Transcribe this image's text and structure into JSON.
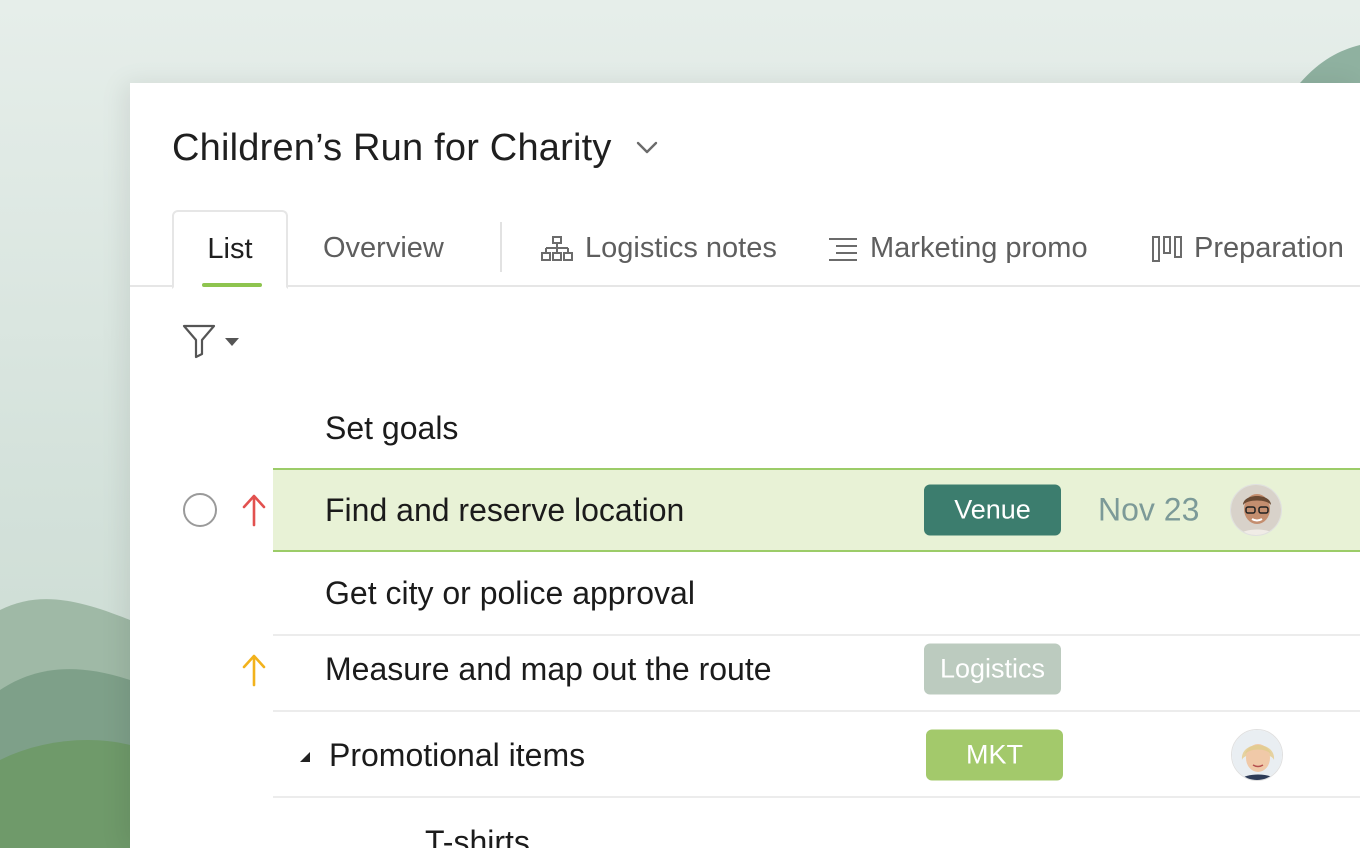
{
  "project": {
    "title": "Children’s Run for Charity"
  },
  "tabs": [
    {
      "label": "List",
      "active": true
    },
    {
      "label": "Overview",
      "active": false
    },
    {
      "label": "Logistics notes",
      "active": false,
      "icon": "hierarchy-icon"
    },
    {
      "label": "Marketing promo",
      "active": false,
      "icon": "text-lines-icon"
    },
    {
      "label": "Preparation",
      "active": false,
      "icon": "board-columns-icon"
    }
  ],
  "filter": {
    "icon": "filter-icon"
  },
  "tasks": [
    {
      "name": "Set goals"
    },
    {
      "name": "Find and reserve location",
      "priority": "high",
      "priority_color": "#e2514f",
      "tag": "Venue",
      "tag_color": "#3c7d6e",
      "due": "Nov 23",
      "assignee": "male-avatar",
      "selected": true
    },
    {
      "name": "Get city or police approval"
    },
    {
      "name": "Measure and map out the route",
      "priority": "medium",
      "priority_color": "#f2b21c",
      "tag": "Logistics",
      "tag_color": "#bccbbf"
    },
    {
      "name": "Promotional items",
      "collapsible": true,
      "expanded": true,
      "tag": "MKT",
      "tag_color": "#a3c96b",
      "assignee": "female-avatar"
    },
    {
      "name": "T-shirts",
      "subtask": true
    }
  ],
  "colors": {
    "accent": "#8ec44f",
    "selected_row_bg": "#e8f2d6",
    "selected_row_border": "#9ccc68",
    "date_text": "#7c9a98"
  }
}
